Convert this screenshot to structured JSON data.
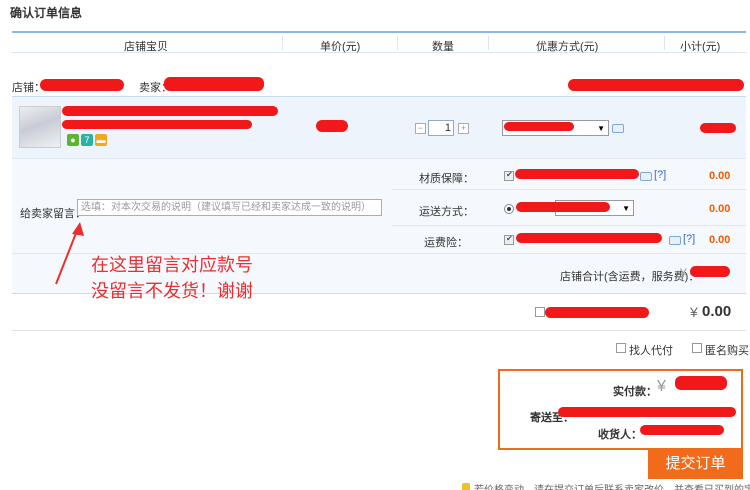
{
  "page_title": "确认订单信息",
  "table_header": {
    "columns": [
      "店铺宝贝",
      "单价(元)",
      "数量",
      "优惠方式(元)",
      "小计(元)"
    ]
  },
  "shop": {
    "shop_label": "店铺：",
    "seller_label": "卖家："
  },
  "item": {
    "quantity": "1",
    "badges": [
      "7"
    ],
    "qty_minus": "−",
    "qty_plus": "+"
  },
  "services": {
    "material_label": "材质保障：",
    "material_price": "0.00",
    "help_mark": "[?]",
    "shipping_label": "运送方式：",
    "shipping_price": "0.00",
    "freight_label": "运费险：",
    "freight_price": "0.00"
  },
  "message": {
    "label": "给卖家留言：",
    "placeholder": "选填：对本次交易的说明（建议填写已经和卖家达成一致的说明）"
  },
  "annotation": {
    "line1": "在这里留言对应款号",
    "line2": "没留言不发货！谢谢"
  },
  "shop_total": {
    "label": "店铺合计(含运费，服务费)：",
    "currency": "¥"
  },
  "grand_total": {
    "currency": "¥",
    "value": "0.00"
  },
  "options": {
    "pay_by_other": "找人代付",
    "anonymous": "匿名购买"
  },
  "summary": {
    "paid_label": "实付款：",
    "currency": "¥",
    "ship_to_label": "寄送至：",
    "receiver_label": "收货人："
  },
  "submit_label": "提交订单",
  "bottom_note": "若价格变动，请在提交订单后联系卖家改价，并查看已买到的宝贝",
  "colors": {
    "accent": "#f26b1a",
    "price": "#f05a00",
    "header_line": "#8db8e5"
  }
}
